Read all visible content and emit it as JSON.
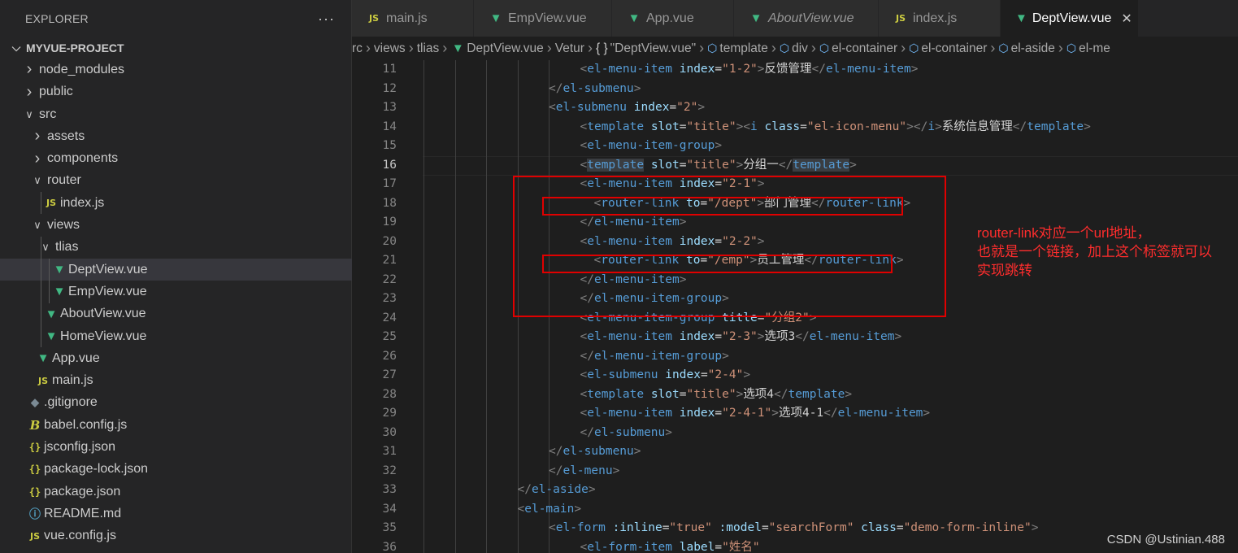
{
  "explorer": {
    "title": "EXPLORER",
    "more": "···",
    "project": "MYVUE-PROJECT",
    "items": [
      {
        "label": "node_modules",
        "kind": "folder",
        "open": false,
        "depth": 1
      },
      {
        "label": "public",
        "kind": "folder",
        "open": false,
        "depth": 1
      },
      {
        "label": "src",
        "kind": "folder",
        "open": true,
        "depth": 1
      },
      {
        "label": "assets",
        "kind": "folder",
        "open": false,
        "depth": 2
      },
      {
        "label": "components",
        "kind": "folder",
        "open": false,
        "depth": 2
      },
      {
        "label": "router",
        "kind": "folder",
        "open": true,
        "depth": 2
      },
      {
        "label": "index.js",
        "kind": "js",
        "depth": 3
      },
      {
        "label": "views",
        "kind": "folder",
        "open": true,
        "depth": 2
      },
      {
        "label": "tlias",
        "kind": "folder",
        "open": true,
        "depth": 3
      },
      {
        "label": "DeptView.vue",
        "kind": "vue",
        "depth": 4,
        "selected": true
      },
      {
        "label": "EmpView.vue",
        "kind": "vue",
        "depth": 4
      },
      {
        "label": "AboutView.vue",
        "kind": "vue",
        "depth": 3
      },
      {
        "label": "HomeView.vue",
        "kind": "vue",
        "depth": 3
      },
      {
        "label": "App.vue",
        "kind": "vue",
        "depth": 2
      },
      {
        "label": "main.js",
        "kind": "js",
        "depth": 2
      },
      {
        "label": ".gitignore",
        "kind": "git",
        "depth": 1
      },
      {
        "label": "babel.config.js",
        "kind": "babel",
        "depth": 1
      },
      {
        "label": "jsconfig.json",
        "kind": "json",
        "depth": 1
      },
      {
        "label": "package-lock.json",
        "kind": "json",
        "depth": 1
      },
      {
        "label": "package.json",
        "kind": "json",
        "depth": 1
      },
      {
        "label": "README.md",
        "kind": "info",
        "depth": 1
      },
      {
        "label": "vue.config.js",
        "kind": "js",
        "depth": 1
      }
    ]
  },
  "tabs": [
    {
      "label": "main.js",
      "kind": "js"
    },
    {
      "label": "EmpView.vue",
      "kind": "vue"
    },
    {
      "label": "App.vue",
      "kind": "vue"
    },
    {
      "label": "AboutView.vue",
      "kind": "vue",
      "italic": true
    },
    {
      "label": "index.js",
      "kind": "js"
    },
    {
      "label": "DeptView.vue",
      "kind": "vue",
      "active": true,
      "close": "✕"
    }
  ],
  "breadcrumb": [
    {
      "label": "rc",
      "icon": ""
    },
    {
      "label": "views",
      "icon": ""
    },
    {
      "label": "tlias",
      "icon": ""
    },
    {
      "label": "DeptView.vue",
      "icon": "vue"
    },
    {
      "label": "Vetur",
      "icon": ""
    },
    {
      "label": "\"DeptView.vue\"",
      "icon": "braces"
    },
    {
      "label": "template",
      "icon": "cube"
    },
    {
      "label": "div",
      "icon": "cube"
    },
    {
      "label": "el-container",
      "icon": "cube"
    },
    {
      "label": "el-container",
      "icon": "cube"
    },
    {
      "label": "el-aside",
      "icon": "cube"
    },
    {
      "label": "el-me",
      "icon": "cube"
    }
  ],
  "editor": {
    "current_line": 16,
    "lines": [
      {
        "n": "11",
        "indent": 6,
        "tokens": [
          [
            "br",
            "<"
          ],
          [
            "tag",
            "el-menu-item"
          ],
          [
            "txt",
            " "
          ],
          [
            "attr",
            "index"
          ],
          [
            "txt",
            "="
          ],
          [
            "str",
            "\"1-2\""
          ],
          [
            "br",
            ">"
          ],
          [
            "txt",
            "反馈管理"
          ],
          [
            "br",
            "</"
          ],
          [
            "tag",
            "el-menu-item"
          ],
          [
            "br",
            ">"
          ]
        ]
      },
      {
        "n": "12",
        "indent": 5,
        "tokens": [
          [
            "br",
            "</"
          ],
          [
            "tag",
            "el-submenu"
          ],
          [
            "br",
            ">"
          ]
        ]
      },
      {
        "n": "13",
        "indent": 5,
        "tokens": [
          [
            "br",
            "<"
          ],
          [
            "tag",
            "el-submenu"
          ],
          [
            "txt",
            " "
          ],
          [
            "attr",
            "index"
          ],
          [
            "txt",
            "="
          ],
          [
            "str",
            "\"2\""
          ],
          [
            "br",
            ">"
          ]
        ]
      },
      {
        "n": "14",
        "indent": 6,
        "tokens": [
          [
            "br",
            "<"
          ],
          [
            "tag",
            "template"
          ],
          [
            "txt",
            " "
          ],
          [
            "attr",
            "slot"
          ],
          [
            "txt",
            "="
          ],
          [
            "str",
            "\"title\""
          ],
          [
            "br",
            ">"
          ],
          [
            "br",
            "<"
          ],
          [
            "tag",
            "i"
          ],
          [
            "txt",
            " "
          ],
          [
            "attr",
            "class"
          ],
          [
            "txt",
            "="
          ],
          [
            "str",
            "\"el-icon-menu\""
          ],
          [
            "br",
            "></"
          ],
          [
            "tag",
            "i"
          ],
          [
            "br",
            ">"
          ],
          [
            "txt",
            "系统信息管理"
          ],
          [
            "br",
            "</"
          ],
          [
            "tag",
            "template"
          ],
          [
            "br",
            ">"
          ]
        ]
      },
      {
        "n": "15",
        "indent": 6,
        "tokens": [
          [
            "br",
            "<"
          ],
          [
            "tag",
            "el-menu-item-group"
          ],
          [
            "br",
            ">"
          ]
        ]
      },
      {
        "n": "16",
        "indent": 6,
        "tokens": [
          [
            "br",
            "<"
          ],
          [
            "tag hl",
            "template"
          ],
          [
            "txt",
            " "
          ],
          [
            "attr",
            "slot"
          ],
          [
            "txt",
            "="
          ],
          [
            "str",
            "\"title\""
          ],
          [
            "br",
            ">"
          ],
          [
            "txt",
            "分组一"
          ],
          [
            "br",
            "</"
          ],
          [
            "tag hl",
            "template"
          ],
          [
            "br",
            ">"
          ]
        ]
      },
      {
        "n": "17",
        "indent": 6,
        "tokens": [
          [
            "br",
            "<"
          ],
          [
            "tag",
            "el-menu-item"
          ],
          [
            "txt",
            " "
          ],
          [
            "attr",
            "index"
          ],
          [
            "txt",
            "="
          ],
          [
            "str",
            "\"2-1\""
          ],
          [
            "br",
            ">"
          ]
        ]
      },
      {
        "n": "18",
        "indent": 6,
        "pre": "  ",
        "tokens": [
          [
            "br",
            "<"
          ],
          [
            "tag",
            "router-link"
          ],
          [
            "txt",
            " "
          ],
          [
            "attr",
            "to"
          ],
          [
            "txt",
            "="
          ],
          [
            "str",
            "\"/dept\""
          ],
          [
            "br",
            ">"
          ],
          [
            "txt",
            "部门管理"
          ],
          [
            "br",
            "</"
          ],
          [
            "tag",
            "router-link"
          ],
          [
            "br",
            ">"
          ]
        ]
      },
      {
        "n": "19",
        "indent": 6,
        "tokens": [
          [
            "br",
            "</"
          ],
          [
            "tag",
            "el-menu-item"
          ],
          [
            "br",
            ">"
          ]
        ]
      },
      {
        "n": "20",
        "indent": 6,
        "tokens": [
          [
            "br",
            "<"
          ],
          [
            "tag",
            "el-menu-item"
          ],
          [
            "txt",
            " "
          ],
          [
            "attr",
            "index"
          ],
          [
            "txt",
            "="
          ],
          [
            "str",
            "\"2-2\""
          ],
          [
            "br",
            ">"
          ]
        ]
      },
      {
        "n": "21",
        "indent": 6,
        "pre": "  ",
        "tokens": [
          [
            "br",
            "<"
          ],
          [
            "tag",
            "router-link"
          ],
          [
            "txt",
            " "
          ],
          [
            "attr",
            "to"
          ],
          [
            "txt",
            "="
          ],
          [
            "str",
            "\"/emp\""
          ],
          [
            "br",
            ">"
          ],
          [
            "txt",
            "员工管理"
          ],
          [
            "br",
            "</"
          ],
          [
            "tag",
            "router-link"
          ],
          [
            "br",
            ">"
          ]
        ]
      },
      {
        "n": "22",
        "indent": 6,
        "tokens": [
          [
            "br",
            "</"
          ],
          [
            "tag",
            "el-menu-item"
          ],
          [
            "br",
            ">"
          ]
        ]
      },
      {
        "n": "23",
        "indent": 6,
        "tokens": [
          [
            "br",
            "</"
          ],
          [
            "tag",
            "el-menu-item-group"
          ],
          [
            "br",
            ">"
          ]
        ]
      },
      {
        "n": "24",
        "indent": 6,
        "tokens": [
          [
            "br",
            "<"
          ],
          [
            "tag",
            "el-menu-item-group"
          ],
          [
            "txt",
            " "
          ],
          [
            "attr",
            "title"
          ],
          [
            "txt",
            "="
          ],
          [
            "str",
            "\"分组2\""
          ],
          [
            "br",
            ">"
          ]
        ]
      },
      {
        "n": "25",
        "indent": 6,
        "tokens": [
          [
            "br",
            "<"
          ],
          [
            "tag",
            "el-menu-item"
          ],
          [
            "txt",
            " "
          ],
          [
            "attr",
            "index"
          ],
          [
            "txt",
            "="
          ],
          [
            "str",
            "\"2-3\""
          ],
          [
            "br",
            ">"
          ],
          [
            "txt",
            "选项3"
          ],
          [
            "br",
            "</"
          ],
          [
            "tag",
            "el-menu-item"
          ],
          [
            "br",
            ">"
          ]
        ]
      },
      {
        "n": "26",
        "indent": 6,
        "tokens": [
          [
            "br",
            "</"
          ],
          [
            "tag",
            "el-menu-item-group"
          ],
          [
            "br",
            ">"
          ]
        ]
      },
      {
        "n": "27",
        "indent": 6,
        "tokens": [
          [
            "br",
            "<"
          ],
          [
            "tag",
            "el-submenu"
          ],
          [
            "txt",
            " "
          ],
          [
            "attr",
            "index"
          ],
          [
            "txt",
            "="
          ],
          [
            "str",
            "\"2-4\""
          ],
          [
            "br",
            ">"
          ]
        ]
      },
      {
        "n": "28",
        "indent": 6,
        "tokens": [
          [
            "br",
            "<"
          ],
          [
            "tag",
            "template"
          ],
          [
            "txt",
            " "
          ],
          [
            "attr",
            "slot"
          ],
          [
            "txt",
            "="
          ],
          [
            "str",
            "\"title\""
          ],
          [
            "br",
            ">"
          ],
          [
            "txt",
            "选项4"
          ],
          [
            "br",
            "</"
          ],
          [
            "tag",
            "template"
          ],
          [
            "br",
            ">"
          ]
        ]
      },
      {
        "n": "29",
        "indent": 6,
        "tokens": [
          [
            "br",
            "<"
          ],
          [
            "tag",
            "el-menu-item"
          ],
          [
            "txt",
            " "
          ],
          [
            "attr",
            "index"
          ],
          [
            "txt",
            "="
          ],
          [
            "str",
            "\"2-4-1\""
          ],
          [
            "br",
            ">"
          ],
          [
            "txt",
            "选项4-1"
          ],
          [
            "br",
            "</"
          ],
          [
            "tag",
            "el-menu-item"
          ],
          [
            "br",
            ">"
          ]
        ]
      },
      {
        "n": "30",
        "indent": 6,
        "tokens": [
          [
            "br",
            "</"
          ],
          [
            "tag",
            "el-submenu"
          ],
          [
            "br",
            ">"
          ]
        ]
      },
      {
        "n": "31",
        "indent": 5,
        "tokens": [
          [
            "br",
            "</"
          ],
          [
            "tag",
            "el-submenu"
          ],
          [
            "br",
            ">"
          ]
        ]
      },
      {
        "n": "32",
        "indent": 5,
        "tokens": [
          [
            "br",
            "</"
          ],
          [
            "tag",
            "el-menu"
          ],
          [
            "br",
            ">"
          ]
        ]
      },
      {
        "n": "33",
        "indent": 4,
        "tokens": [
          [
            "br",
            "</"
          ],
          [
            "tag",
            "el-aside"
          ],
          [
            "br",
            ">"
          ]
        ]
      },
      {
        "n": "34",
        "indent": 4,
        "tokens": [
          [
            "br",
            "<"
          ],
          [
            "tag",
            "el-main"
          ],
          [
            "br",
            ">"
          ]
        ]
      },
      {
        "n": "35",
        "indent": 5,
        "tokens": [
          [
            "br",
            "<"
          ],
          [
            "tag",
            "el-form"
          ],
          [
            "txt",
            " "
          ],
          [
            "attr",
            ":inline"
          ],
          [
            "txt",
            "="
          ],
          [
            "str",
            "\"true\""
          ],
          [
            "txt",
            " "
          ],
          [
            "attr",
            ":model"
          ],
          [
            "txt",
            "="
          ],
          [
            "str",
            "\"searchForm\""
          ],
          [
            "txt",
            " "
          ],
          [
            "attr",
            "class"
          ],
          [
            "txt",
            "="
          ],
          [
            "str",
            "\"demo-form-inline\""
          ],
          [
            "br",
            ">"
          ]
        ]
      },
      {
        "n": "36",
        "indent": 6,
        "tokens": [
          [
            "br",
            "<"
          ],
          [
            "tag",
            "el-form-item"
          ],
          [
            "txt",
            " "
          ],
          [
            "attr",
            "label"
          ],
          [
            "txt",
            "="
          ],
          [
            "str",
            "\"姓名\""
          ]
        ]
      }
    ]
  },
  "annotation": {
    "lines": [
      "router-link对应一个url地址，",
      "也就是一个链接，加上这个标签就可以",
      "实现跳转"
    ]
  },
  "watermark": "CSDN @Ustinian.488",
  "colors": {
    "annotation": "#e00000",
    "vue": "#41b883",
    "js": "#cbcb41"
  }
}
